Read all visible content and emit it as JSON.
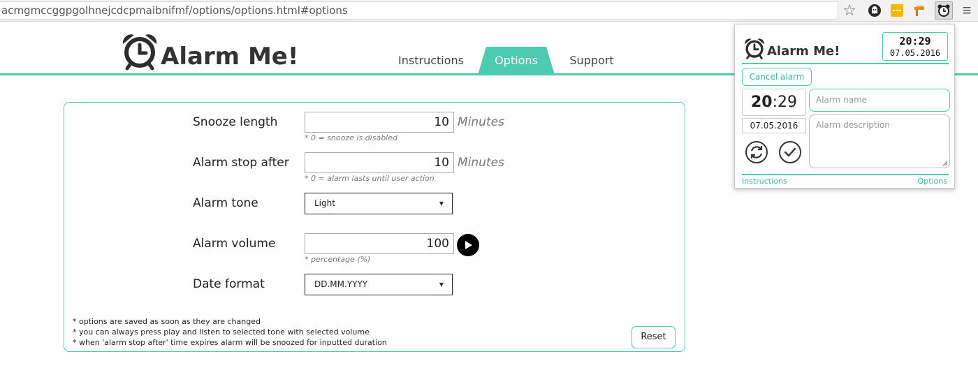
{
  "browser": {
    "url": "acmgmccggpgolhnejcdcpmaibnifmf/options/options.html#options",
    "extension_icons": [
      "star-icon",
      "ghostery-icon",
      "yellow-extension-icon",
      "orange-extension-icon",
      "alarm-clock-icon",
      "menu-icon"
    ]
  },
  "header": {
    "logo_text": "Alarm Me!",
    "nav": {
      "instructions": "Instructions",
      "options": "Options",
      "support": "Support"
    },
    "active_tab": "Options"
  },
  "options": {
    "snooze": {
      "label": "Snooze length",
      "value": "10",
      "unit": "Minutes",
      "hint": "* 0 = snooze is disabled"
    },
    "stop_after": {
      "label": "Alarm stop after",
      "value": "10",
      "unit": "Minutes",
      "hint": "* 0 = alarm lasts until user action"
    },
    "tone": {
      "label": "Alarm tone",
      "selected": "Light"
    },
    "volume": {
      "label": "Alarm volume",
      "value": "100",
      "hint": "* percentage (%)"
    },
    "date_format": {
      "label": "Date format",
      "selected": "DD.MM.YYYY"
    },
    "notes": [
      "* options are saved as soon as they are changed",
      "* you can always press play and listen to selected tone with selected volume",
      "* when 'alarm stop after' time expires alarm will be snoozed for inputted duration"
    ],
    "reset_label": "Reset"
  },
  "popup": {
    "logo_text": "Alarm Me!",
    "clock_time": "20:29",
    "clock_date": "07.05.2016",
    "cancel_label": "Cancel alarm",
    "alarm_hour": "20",
    "alarm_separator": ":",
    "alarm_minute": "29",
    "alarm_date": "07.05.2016",
    "name_placeholder": "Alarm name",
    "description_placeholder": "Alarm description",
    "footer": {
      "instructions": "Instructions",
      "options": "Options"
    }
  },
  "colors": {
    "accent": "#4ccbb0",
    "accent_text": "#3fb79b"
  }
}
